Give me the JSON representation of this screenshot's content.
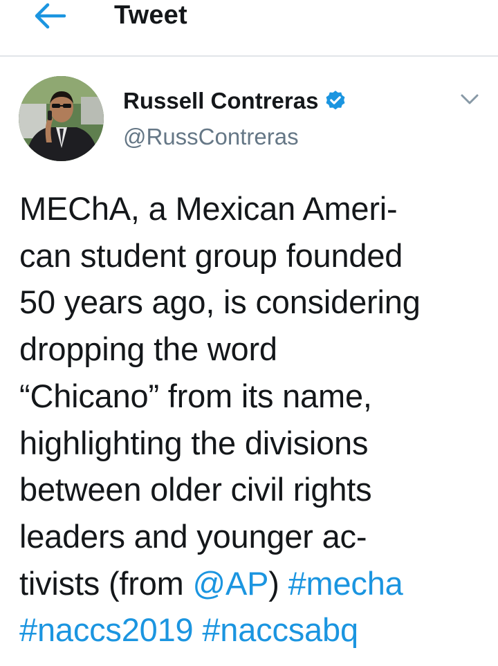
{
  "header": {
    "back_icon": "arrow-left-icon",
    "title": "Tweet"
  },
  "tweet": {
    "author": {
      "name": "Russell Contreras",
      "handle": "@RussContreras",
      "verified": true,
      "verified_icon": "verified-badge-icon"
    },
    "menu_icon": "chevron-down-icon",
    "text_lines": [
      [
        {
          "type": "text",
          "value": "MEChA, a Mexican Ameri-"
        }
      ],
      [
        {
          "type": "text",
          "value": "can student group founded"
        }
      ],
      [
        {
          "type": "text",
          "value": "50 years ago, is considering"
        }
      ],
      [
        {
          "type": "text",
          "value": "dropping the word"
        }
      ],
      [
        {
          "type": "text",
          "value": "“Chicano” from its name,"
        }
      ],
      [
        {
          "type": "text",
          "value": "highlighting the divisions"
        }
      ],
      [
        {
          "type": "text",
          "value": "between older civil rights"
        }
      ],
      [
        {
          "type": "text",
          "value": "leaders and younger ac-"
        }
      ],
      [
        {
          "type": "text",
          "value": "tivists (from "
        },
        {
          "type": "mention",
          "value": "@AP"
        },
        {
          "type": "text",
          "value": ") "
        },
        {
          "type": "hashtag",
          "value": "#mecha"
        }
      ],
      [
        {
          "type": "hashtag",
          "value": "#naccs2019"
        },
        {
          "type": "text",
          "value": " "
        },
        {
          "type": "hashtag",
          "value": "#naccsabq"
        }
      ]
    ]
  },
  "colors": {
    "accent": "#1b95e0",
    "text": "#14171a",
    "secondary": "#657786",
    "divider": "#e1e4e8"
  }
}
